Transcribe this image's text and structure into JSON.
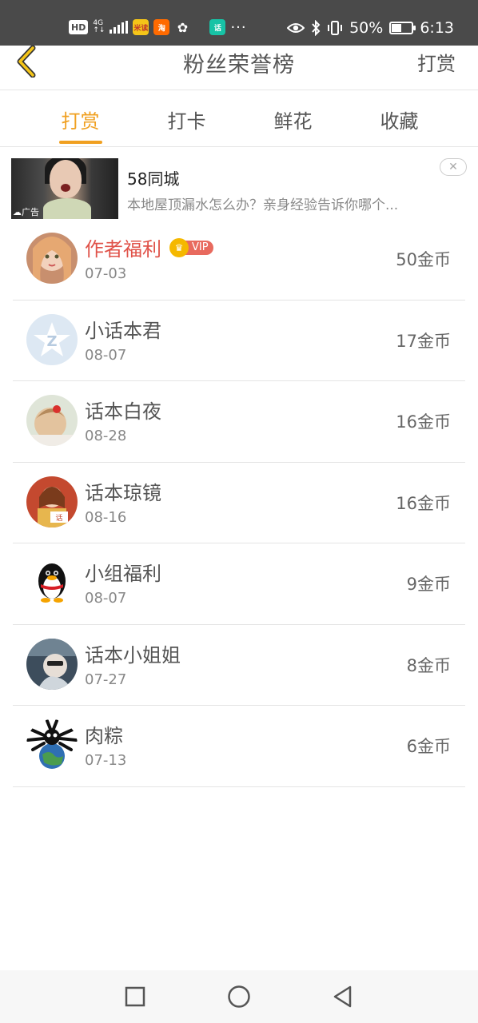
{
  "status_bar": {
    "badge_hd": "HD",
    "network_top": "4G",
    "network_bottom": "↑↓",
    "app1": "米读",
    "app2": "淘",
    "app3": "✿",
    "app4": "话",
    "more": "···",
    "battery_text": "50%",
    "battery_level": 0.5,
    "time": "6:13"
  },
  "nav": {
    "title": "粉丝荣誉榜",
    "action_label": "打赏",
    "accent_color": "#f0a021"
  },
  "tabs": [
    {
      "label": "打赏",
      "active": true
    },
    {
      "label": "打卡",
      "active": false
    },
    {
      "label": "鲜花",
      "active": false
    },
    {
      "label": "收藏",
      "active": false
    }
  ],
  "ad": {
    "title": "58同城",
    "description": "本地屋顶漏水怎么办？亲身经验告诉你哪个...",
    "label": "☁广告",
    "close_icon": "close-icon"
  },
  "rankings": [
    {
      "name": "作者福利",
      "date": "07-03",
      "coins": "50金币",
      "vip": true,
      "vip_label": "VIP"
    },
    {
      "name": "小话本君",
      "date": "08-07",
      "coins": "17金币",
      "vip": false
    },
    {
      "name": "话本白夜",
      "date": "08-28",
      "coins": "16金币",
      "vip": false
    },
    {
      "name": "话本琼镜",
      "date": "08-16",
      "coins": "16金币",
      "vip": false
    },
    {
      "name": "小组福利",
      "date": "08-07",
      "coins": "9金币",
      "vip": false
    },
    {
      "name": "话本小姐姐",
      "date": "07-27",
      "coins": "8金币",
      "vip": false
    },
    {
      "name": "肉粽",
      "date": "07-13",
      "coins": "6金币",
      "vip": false
    }
  ],
  "colors": {
    "highlight_name": "#e0534a",
    "vip_badge": "#e86a5e",
    "crown": "#f5b800"
  }
}
